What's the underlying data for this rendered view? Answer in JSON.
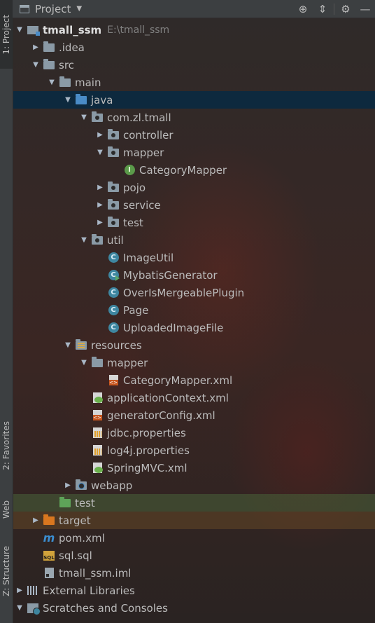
{
  "header": {
    "title": "Project",
    "dropdown_icon": "chevron-down-icon",
    "tools": [
      "locate-icon",
      "collapse-all-icon",
      "gear-icon",
      "minimize-icon"
    ]
  },
  "side_tabs": {
    "project": "1: Project",
    "favorites": "2: Favorites",
    "web": "Web",
    "structure": "Z: Structure"
  },
  "tree": [
    {
      "label": "tmall_ssm",
      "path": "E:\\tmall_ssm"
    },
    {
      "label": ".idea"
    },
    {
      "label": "src"
    },
    {
      "label": "main"
    },
    {
      "label": "java"
    },
    {
      "label": "com.zl.tmall"
    },
    {
      "label": "controller"
    },
    {
      "label": "mapper"
    },
    {
      "label": "CategoryMapper"
    },
    {
      "label": "pojo"
    },
    {
      "label": "service"
    },
    {
      "label": "test"
    },
    {
      "label": "util"
    },
    {
      "label": "ImageUtil"
    },
    {
      "label": "MybatisGenerator"
    },
    {
      "label": "OverIsMergeablePlugin"
    },
    {
      "label": "Page"
    },
    {
      "label": "UploadedImageFile"
    },
    {
      "label": "resources"
    },
    {
      "label": "mapper"
    },
    {
      "label": "CategoryMapper.xml"
    },
    {
      "label": "applicationContext.xml"
    },
    {
      "label": "generatorConfig.xml"
    },
    {
      "label": "jdbc.properties"
    },
    {
      "label": "log4j.properties"
    },
    {
      "label": "SpringMVC.xml"
    },
    {
      "label": "webapp"
    },
    {
      "label": "test"
    },
    {
      "label": "target"
    },
    {
      "label": "pom.xml",
      "icon_text": "m"
    },
    {
      "label": "sql.sql",
      "icon_text": "SQL"
    },
    {
      "label": "tmall_ssm.iml"
    },
    {
      "label": "External Libraries"
    },
    {
      "label": "Scratches and Consoles"
    }
  ],
  "icon_glyphs": {
    "class": "C",
    "interface": "I"
  }
}
